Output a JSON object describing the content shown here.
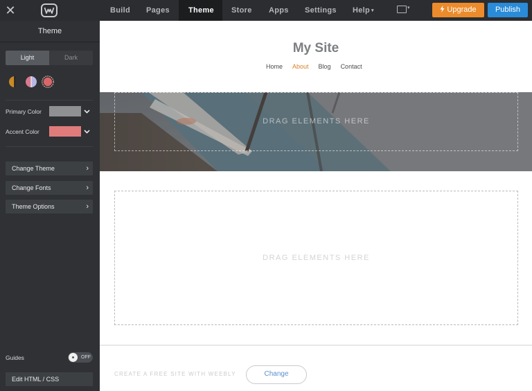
{
  "topbar": {
    "close_glyph": "✕",
    "logo_icon": "weebly-logo",
    "nav": [
      {
        "label": "Build",
        "active": false
      },
      {
        "label": "Pages",
        "active": false
      },
      {
        "label": "Theme",
        "active": true
      },
      {
        "label": "Store",
        "active": false
      },
      {
        "label": "Apps",
        "active": false
      },
      {
        "label": "Settings",
        "active": false
      },
      {
        "label": "Help",
        "active": false,
        "caret": "▾"
      }
    ],
    "device_icon": "desktop-preview-icon",
    "device_caret": "▾",
    "upgrade_label": "Upgrade",
    "publish_label": "Publish",
    "colors": {
      "bar": "#2b2d30",
      "upgrade": "#ec8b2b",
      "publish": "#2a8bd8"
    }
  },
  "sidebar": {
    "title": "Theme",
    "mode": {
      "light": "Light",
      "dark": "Dark",
      "selected": "Light"
    },
    "color_swatches": [
      "palette-swatch-gold",
      "palette-swatch-lilac",
      "palette-swatch-coral"
    ],
    "primary": {
      "label": "Primary Color",
      "color": "#8f9092"
    },
    "accent": {
      "label": "Accent Color",
      "color": "#e07b7b"
    },
    "menu": [
      {
        "label": "Change Theme",
        "chevron": "›"
      },
      {
        "label": "Change Fonts",
        "chevron": "›"
      },
      {
        "label": "Theme Options",
        "chevron": "›"
      }
    ],
    "guides": {
      "label": "Guides",
      "state": "OFF"
    },
    "edit_html_label": "Edit HTML / CSS"
  },
  "canvas": {
    "site_title": "My Site",
    "site_nav": [
      {
        "label": "Home",
        "current": false
      },
      {
        "label": "About",
        "current": true
      },
      {
        "label": "Blog",
        "current": false
      },
      {
        "label": "Contact",
        "current": false
      }
    ],
    "banner_drop_text": "DRAG ELEMENTS HERE",
    "content_drop_text": "DRAG ELEMENTS HERE",
    "footer_text": "CREATE A FREE SITE WITH WEEBLY",
    "footer_button": "Change",
    "colors": {
      "nav_current": "#d9822b",
      "footer_button_text": "#5a8fcf"
    }
  }
}
